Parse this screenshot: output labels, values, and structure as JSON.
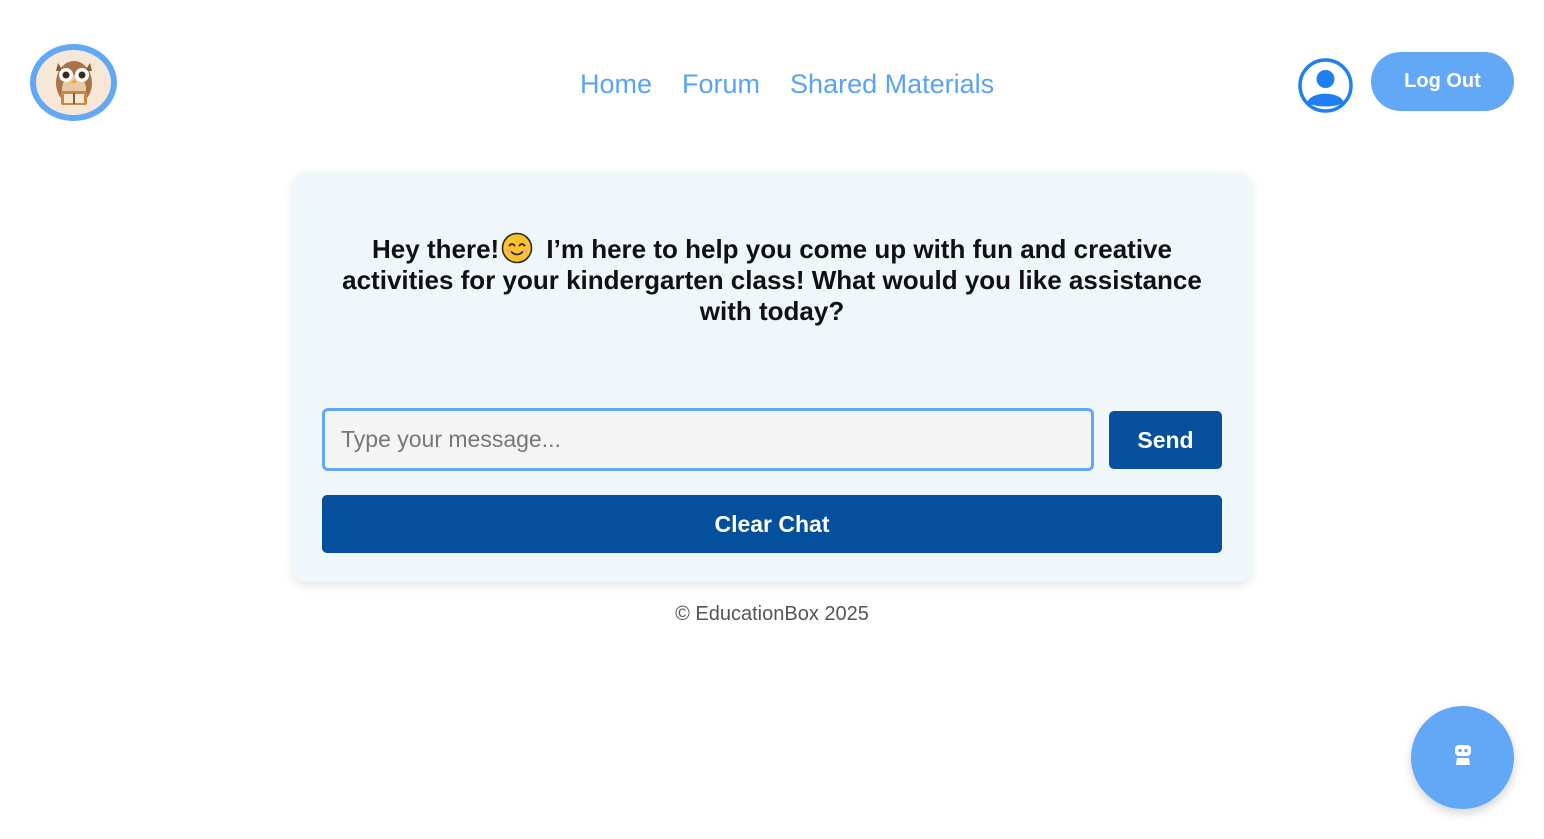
{
  "header": {
    "logo_icon": "owl-reading-book-icon",
    "nav": [
      {
        "label": "Home"
      },
      {
        "label": "Forum"
      },
      {
        "label": "Shared Materials"
      }
    ],
    "profile_icon": "user-avatar-icon",
    "logout_label": "Log Out"
  },
  "chat": {
    "greeting_before_emoji": "Hey there!",
    "greeting_emoji": "smiling-face-icon",
    "greeting_after_emoji": "I’m here to help you come up with fun and creative activities for your kindergarten class! What would you like assistance with today?",
    "input_placeholder": "Type your message...",
    "input_value": "",
    "send_label": "Send",
    "clear_label": "Clear Chat"
  },
  "footer": {
    "text": "© EducationBox 2025"
  },
  "floating": {
    "icon": "robot-icon"
  },
  "colors": {
    "accent": "#62a8f7",
    "primary_button": "#05509c",
    "nav_link": "#5aa3f2",
    "card_bg": "#f0f7fb"
  }
}
